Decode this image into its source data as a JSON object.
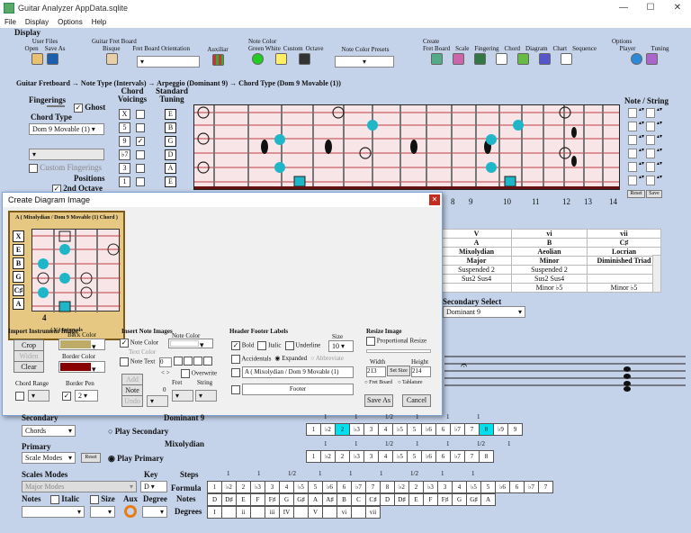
{
  "window": {
    "title": "Guitar Analyzer  AppData.sqlite"
  },
  "menu": [
    "File",
    "Display",
    "Options",
    "Help"
  ],
  "toolbar": {
    "display": "Display",
    "user_files": "User Files",
    "open": "Open",
    "save_as": "Save As",
    "guitar_fret_board": "Guitar Fret Board",
    "bisque": "Bisque",
    "orientation": "Fret Board Orientation",
    "auxiliar": "Auxiliar",
    "note_color": "Note Color",
    "green_white": "Green White",
    "custom": "Custom",
    "octave": "Octave",
    "presets": "Note Color Presets",
    "create": "Create",
    "fret_board": "Fret Board",
    "scale": "Scale",
    "fingering": "Fingering",
    "chord": "Chord",
    "diagram": "Diagram",
    "chart": "Chart",
    "sequence": "Sequence",
    "options": "Options",
    "player": "Player",
    "tuning": "Tuning"
  },
  "breadcrumb": "Guitar Fretboard  →  Note Type (Intervals)  →  Arpeggio (Dominant 9)  →  Chord Type  (Dom 9 Movable (1))",
  "left": {
    "fingerings": "Fingerings",
    "ghost": "Ghost",
    "chord_type": "Chord Type",
    "chord_type_value": "Dom 9 Movable (1)",
    "custom_fingerings": "Custom Fingerings",
    "positions": "Positions",
    "second_octave": "2nd Octave"
  },
  "chord_voicings": {
    "title": "Chord Voicings",
    "rows": [
      "X",
      "5",
      "9",
      "♭7",
      "3",
      "1"
    ],
    "checked": [
      false,
      false,
      true,
      false,
      false,
      false
    ]
  },
  "standard_tuning": {
    "title": "Standard Tuning",
    "strings": [
      "E",
      "B",
      "G",
      "D",
      "A",
      "E"
    ]
  },
  "note_string": {
    "title": "Note / String",
    "reset": "Reset",
    "save": "Save"
  },
  "fret_numbers": [
    "8",
    "9",
    "10",
    "11",
    "12",
    "13",
    "14"
  ],
  "dialog": {
    "title": "Create Diagram Image",
    "diagram_header": "A ( Mixolydian  /  Dom 9 Movable (1)  Chord )",
    "diagram_footer": "( V ) Intervals",
    "fret_label": "4",
    "string_labels": [
      "X",
      "E",
      "B",
      "G",
      "C♯",
      "A"
    ],
    "import_instrument_image": "Import Instrument Image",
    "back_color": "Back Color",
    "crop": "Crop",
    "widen": "Widen",
    "clear": "Clear",
    "border_color": "Border Color",
    "chord_range": "Chord Range",
    "border_pen": "Border Pen",
    "border_pen_value": "2",
    "insert_note_images": "Insert Note Images",
    "note_color": "Note Color",
    "note_color_label": "Note Color",
    "text_color": "Text Color",
    "note_text": "Note Text",
    "note_text_value": "0",
    "add": "Add",
    "note_btn": "Note",
    "undo": "Undo",
    "note_value": "0",
    "overwrite": "Overwrite",
    "fret": "Fret",
    "string": "String",
    "header_footer_labels": "Header Footer Labels",
    "size": "Size",
    "size_value": "10",
    "bold": "Bold",
    "italic": "Italic",
    "underline": "Underline",
    "accidentals": "Accidentals",
    "expanded": "Expanded",
    "abbreviate": "Abbreviate",
    "header_text": "A ( Mixolydian  /  Dom 9 Movable (1)",
    "footer_text": "Footer",
    "resize_image": "Resize Image",
    "proportional_resize": "Proportional Resize",
    "width": "Width",
    "height": "Height",
    "width_value": "213",
    "height_value": "214",
    "set_size": "Set Size",
    "fret_board_opt": "Fret Board",
    "tablature": "Tablature",
    "save_as": "Save As",
    "cancel": "Cancel"
  },
  "modes_table": {
    "header": [
      "V",
      "vi",
      "vii"
    ],
    "keys": [
      "A",
      "B",
      "C♯"
    ],
    "modes": [
      "Mixolydian",
      "Aeolian",
      "Locrian"
    ],
    "quality": [
      "Major",
      "Minor",
      "Diminished Triad"
    ],
    "row_a": [
      "Suspended 2",
      "Suspended 2",
      ""
    ],
    "row_b": [
      "Sus2 Sus4",
      "Sus2 Sus4",
      ""
    ],
    "row_c": [
      "",
      "Minor ♭5",
      "Minor ♭5"
    ]
  },
  "secondary_select": {
    "label": "Secondary Select",
    "value": "Dominant 9"
  },
  "bottom": {
    "secondary": "Secondary",
    "dominant9": "Dominant 9",
    "chords": "Chords",
    "play_secondary": "Play Secondary",
    "mixolydian": "Mixolydian",
    "primary": "Primary",
    "scale_modes_value": "Scale Modes",
    "reset": "Reset",
    "play_primary": "Play Primary",
    "scales_modes": "Scales Modes",
    "key": "Key",
    "key_value": "D",
    "steps": "Steps",
    "major_modes": "Major Modes",
    "formula": "Formula",
    "notes": "Notes",
    "italic": "Italic",
    "size": "Size",
    "aux": "Aux",
    "degree": "Degree",
    "degrees": "Degrees"
  },
  "interval_rows": {
    "secondary_steps": [
      "1",
      "1",
      "1/2",
      "1",
      "1",
      "1"
    ],
    "secondary": [
      "1",
      "♭2",
      "2",
      "♭3",
      "3",
      "4",
      "♭5",
      "5",
      "♭6",
      "6",
      "♭7",
      "7",
      "8",
      "♭9",
      "9"
    ],
    "secondary_hl": [
      2,
      12
    ],
    "primary_steps": [
      "1",
      "1",
      "1/2",
      "1",
      "1",
      "1/2",
      "1"
    ],
    "primary": [
      "1",
      "♭2",
      "2",
      "♭3",
      "3",
      "4",
      "♭5",
      "5",
      "♭6",
      "6",
      "♭7",
      "7",
      "8"
    ],
    "formula_steps": [
      "1",
      "1",
      "1/2",
      "1",
      "1",
      "1",
      "1/2",
      "1",
      "1"
    ],
    "formula": [
      "1",
      "♭2",
      "2",
      "♭3",
      "3",
      "4",
      "♭5",
      "5",
      "♭6",
      "6",
      "♭7",
      "7",
      "8",
      "♭2",
      "2",
      "♭3",
      "3",
      "4",
      "♭5",
      "5",
      "♭6",
      "6",
      "♭7",
      "7"
    ],
    "notes": [
      "D",
      "D♯",
      "E",
      "F",
      "F♯",
      "G",
      "G♯",
      "A",
      "A♯",
      "B",
      "C",
      "C♯",
      "D",
      "D♯",
      "E",
      "F",
      "F♯",
      "G",
      "G♯",
      "A"
    ],
    "degrees": [
      "I",
      "",
      "ii",
      "",
      "iii",
      "IV",
      "",
      "V",
      "",
      "vi",
      "",
      "vii"
    ]
  },
  "colors": {
    "accent": "#1fb6c8",
    "highlight": "#00e0ef",
    "fretboard": "#f7e5e8",
    "background": "#c4d2ea"
  }
}
